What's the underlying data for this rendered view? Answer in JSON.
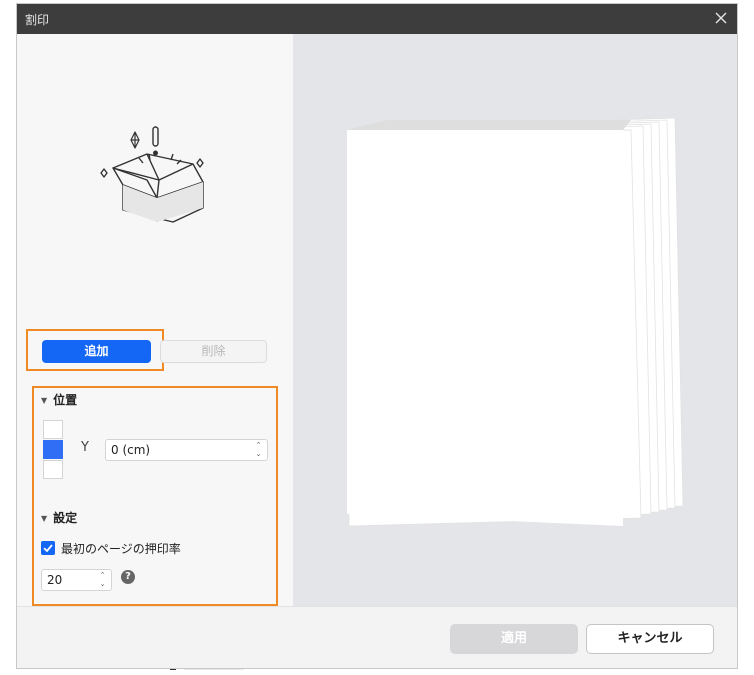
{
  "window": {
    "title": "割印"
  },
  "actions": {
    "add_label": "追加",
    "delete_label": "削除"
  },
  "position": {
    "heading": "位置",
    "axis_label": "Y",
    "y_value": "0 (cm)",
    "selected_cell": "middle"
  },
  "settings": {
    "heading": "設定",
    "first_page_label": "最初のページの押印率",
    "first_page_checked": true,
    "rate_value": "20",
    "help_glyph": "?"
  },
  "footer": {
    "apply_label": "適用",
    "cancel_label": "キャンセル"
  },
  "icons": {
    "close": "close-icon",
    "illustration": "open-box-icon",
    "help": "question-icon"
  },
  "colors": {
    "accent": "#1466f5",
    "highlight": "#f08a24",
    "titlebar": "#3d3d3d"
  }
}
